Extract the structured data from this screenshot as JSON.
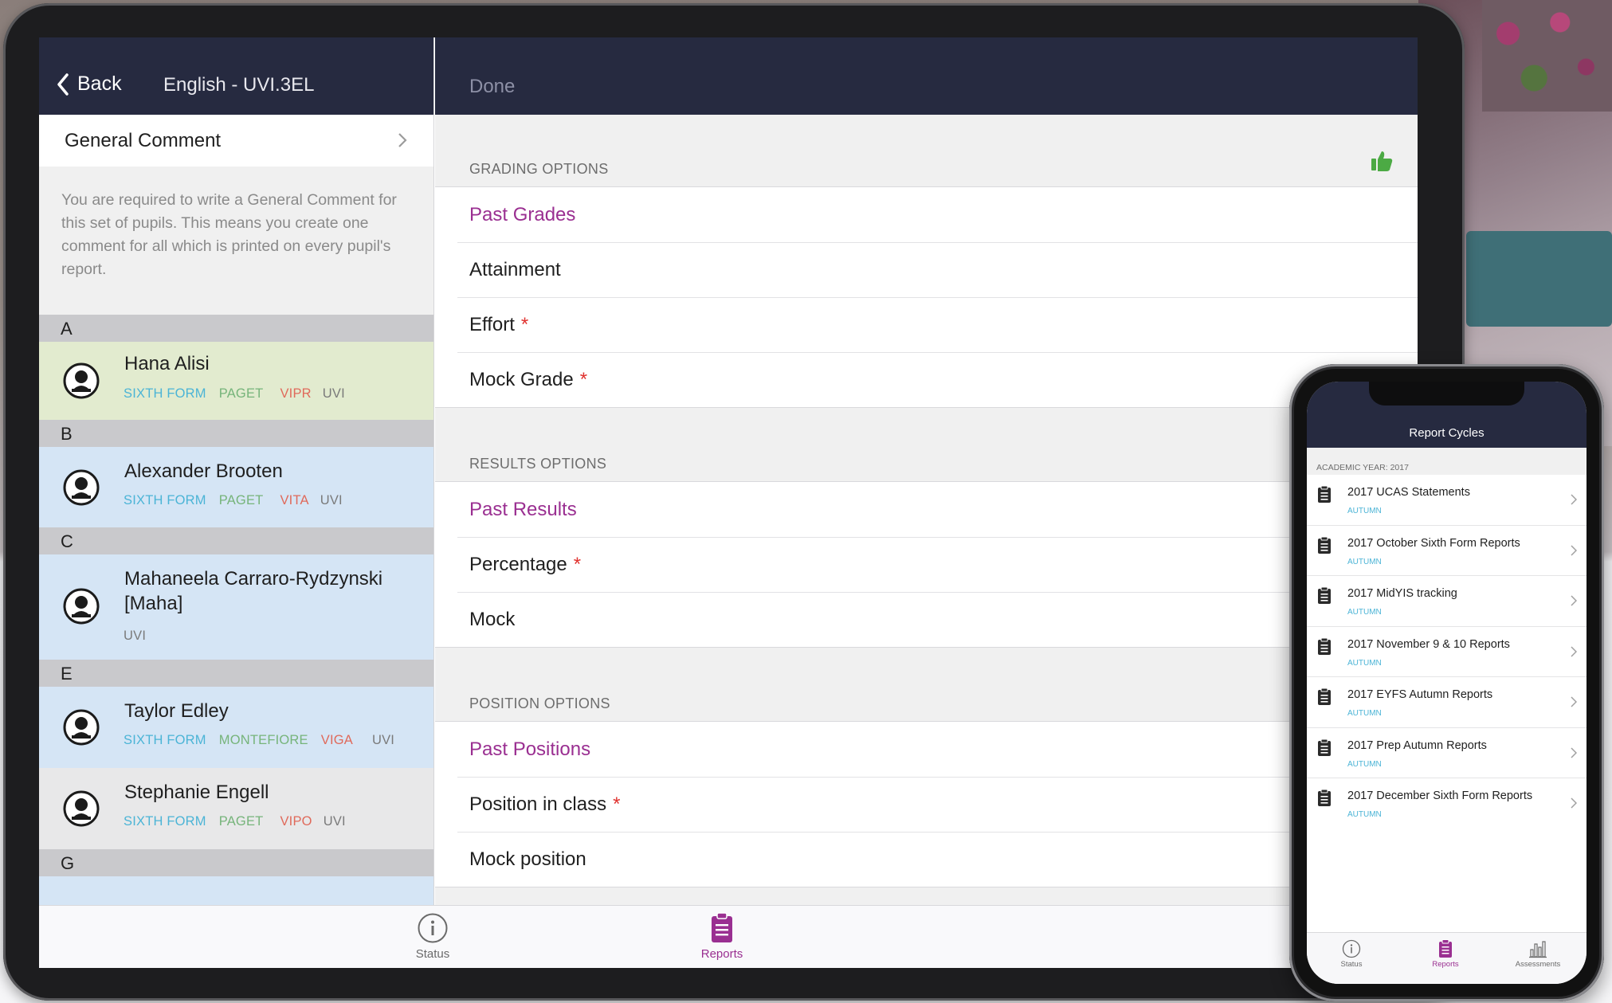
{
  "tablet": {
    "left_nav": {
      "back_label": "Back",
      "title": "English - UVI.3EL"
    },
    "general_comment": {
      "label": "General Comment",
      "note": "You are required to write a General Comment for this set of pupils. This means you create one comment for all which is printed on every pupil's report."
    },
    "sections": [
      "A",
      "B",
      "C",
      "E",
      "G"
    ],
    "pupils": [
      {
        "name": "Hana Alisi",
        "tags": [
          "SIXTH FORM",
          "PAGET",
          "VIPR",
          "UVI"
        ],
        "bg": "#e2ebcf"
      },
      {
        "name": "Alexander Brooten",
        "tags": [
          "SIXTH FORM",
          "PAGET",
          "VITA",
          "UVI"
        ],
        "bg": "#d5e5f5"
      },
      {
        "name": "Mahaneela Carraro-Rydzynski",
        "name2": "[Maha]",
        "tags": [
          "UVI"
        ],
        "bg": "#d5e5f5"
      },
      {
        "name": "Taylor Edley",
        "tags": [
          "SIXTH FORM",
          "MONTEFIORE",
          "VIGA",
          "UVI"
        ],
        "bg": "#d5e5f5"
      },
      {
        "name": "Stephanie Engell",
        "tags": [
          "SIXTH FORM",
          "PAGET",
          "VIPO",
          "UVI"
        ],
        "bg": "#e8e8e9"
      }
    ],
    "right_nav": {
      "done_label": "Done"
    },
    "grading": {
      "header": "GRADING OPTIONS",
      "items": [
        {
          "label": "Past Grades",
          "required": ""
        },
        {
          "label": "Attainment",
          "required": ""
        },
        {
          "label": "Effort",
          "required": "*"
        },
        {
          "label": "Mock Grade",
          "required": "*"
        }
      ]
    },
    "results": {
      "header": "RESULTS OPTIONS",
      "items": [
        {
          "label": "Past Results",
          "required": ""
        },
        {
          "label": "Percentage",
          "required": "*"
        },
        {
          "label": "Mock",
          "required": ""
        }
      ]
    },
    "position": {
      "header": "POSITION OPTIONS",
      "items": [
        {
          "label": "Past Positions",
          "required": ""
        },
        {
          "label": "Position in class",
          "required": "*"
        },
        {
          "label": "Mock position",
          "required": ""
        }
      ]
    },
    "tabs": [
      {
        "label": "Status",
        "icon": "info-icon"
      },
      {
        "label": "Reports",
        "icon": "clipboard-icon"
      }
    ],
    "colors": {
      "nav": "#262a40",
      "accent": "#9a2f91",
      "thumb": "#4caa44",
      "required": "#e0312e"
    }
  },
  "phone": {
    "title": "Report Cycles",
    "academic_year": "ACADEMIC YEAR: 2017",
    "cycles": [
      {
        "title": "2017 UCAS Statements",
        "term": "AUTUMN"
      },
      {
        "title": "2017 October Sixth Form Reports",
        "term": "AUTUMN"
      },
      {
        "title": "2017 MidYIS tracking",
        "term": "AUTUMN"
      },
      {
        "title": "2017 November 9 & 10 Reports",
        "term": "AUTUMN"
      },
      {
        "title": "2017 EYFS Autumn Reports",
        "term": "AUTUMN"
      },
      {
        "title": "2017 Prep Autumn Reports",
        "term": "AUTUMN"
      },
      {
        "title": "2017 December Sixth Form Reports",
        "term": "AUTUMN"
      }
    ],
    "tabs": [
      {
        "label": "Status",
        "icon": "info-icon"
      },
      {
        "label": "Reports",
        "icon": "clipboard-icon"
      },
      {
        "label": "Assessments",
        "icon": "bar-chart-icon"
      }
    ]
  }
}
